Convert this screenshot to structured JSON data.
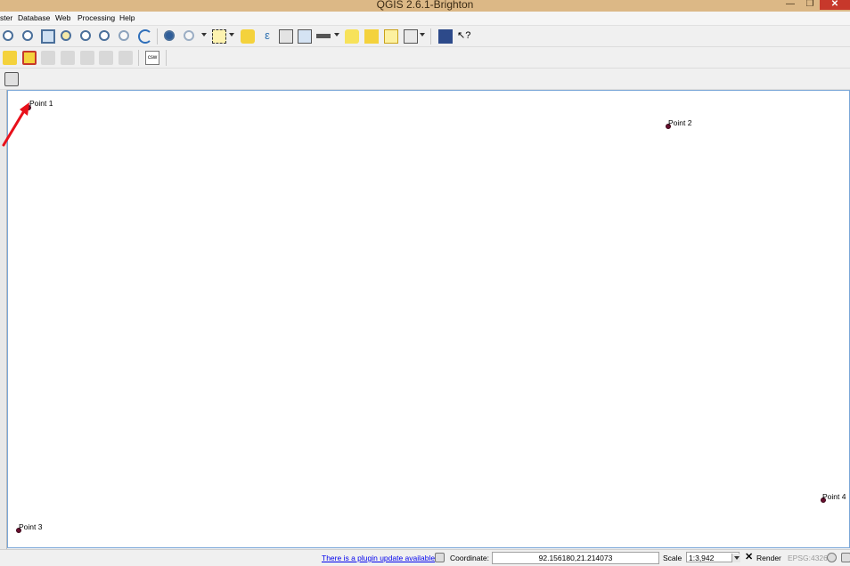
{
  "window": {
    "title": "QGIS 2.6.1-Brighton",
    "min": "—",
    "max": "❐",
    "close": "✕"
  },
  "menu": [
    "ster",
    "Database",
    "Web",
    "Processing",
    "Help"
  ],
  "toolbar1": {
    "icons": [
      "pan-icon",
      "zoom-in-icon",
      "zoom-out-icon",
      "zoom-full-icon",
      "zoom-to-selection-icon",
      "zoom-to-layer-icon",
      "zoom-last-icon",
      "zoom-next-icon",
      "refresh-icon",
      "identify-icon",
      "measure-icon",
      "select-features-icon",
      "deselect-icon",
      "expression-select-icon",
      "attribute-table-icon",
      "field-calculator-icon",
      "measure-line-icon",
      "text-annotation-icon",
      "form-annotation-icon",
      "move-annotation-icon",
      "tips-icon",
      "help-icon",
      "whats-this-icon"
    ],
    "accent": "#4a6f9a"
  },
  "toolbar2": {
    "icons": [
      "label-icon",
      "layer-labeling-icon",
      "pin-labels-icon",
      "show-hide-labels-icon",
      "move-label-icon",
      "rotate-label-icon",
      "change-label-icon"
    ],
    "csw_label": "csw"
  },
  "toolbar3": {
    "icons": [
      "print-composer-icon"
    ]
  },
  "map": {
    "points": [
      {
        "label": "Point 1"
      },
      {
        "label": "Point 2"
      },
      {
        "label": "Point 3"
      },
      {
        "label": "Point 4"
      }
    ],
    "point_color": "#6a1030",
    "annotation_arrow_color": "#e8101a"
  },
  "status": {
    "plugin_update": "There is a plugin update available",
    "coordinate_label": "Coordinate:",
    "coordinate_value": "92.156180,21.214073",
    "scale_label": "Scale",
    "scale_value": "1:3,942",
    "render_label": "Render",
    "crs": "EPSG:4326"
  }
}
